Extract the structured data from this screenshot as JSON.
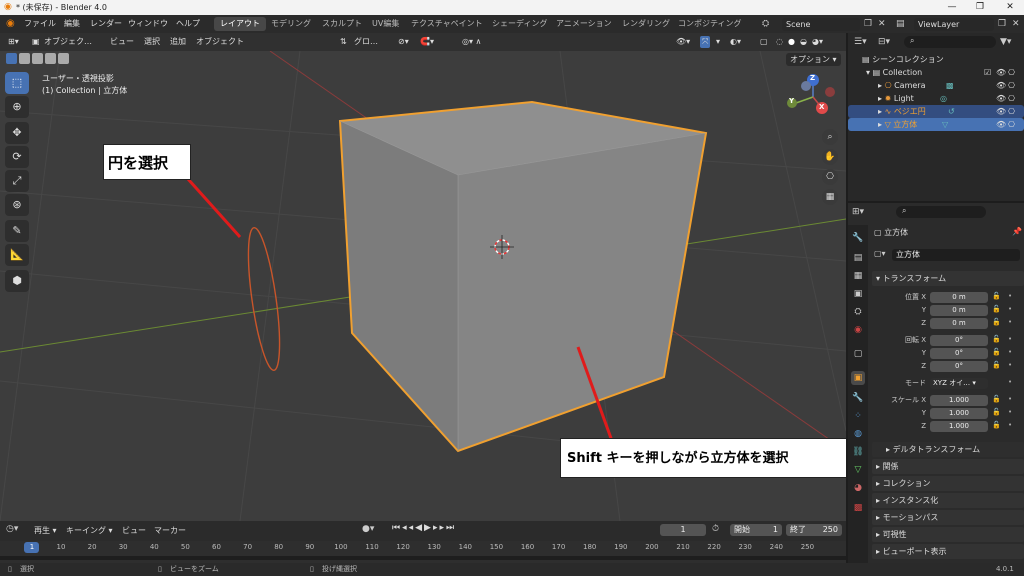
{
  "title_bar": {
    "text": "* (未保存) - Blender 4.0",
    "min": "—",
    "max": "❐",
    "close": "✕"
  },
  "menu": {
    "items": [
      "ファイル",
      "編集",
      "レンダー",
      "ウィンドウ",
      "ヘルプ"
    ],
    "workspaces": [
      "レイアウト",
      "モデリング",
      "スカルプト",
      "UV編集",
      "テクスチャペイント",
      "シェーディング",
      "アニメーション",
      "レンダリング",
      "コンポジティング"
    ],
    "scene": "Scene",
    "view_layer": "ViewLayer"
  },
  "viewport_header": {
    "mode": "オブジェク…",
    "menus": [
      "ビュー",
      "選択",
      "追加",
      "オブジェクト"
    ],
    "transform_orientation": "グロ…",
    "options": "オプション"
  },
  "viewport": {
    "view_name": "ユーザー・透視投影",
    "context": "(1) Collection | 立方体",
    "gizmo": {
      "z": "Z",
      "y": "Y",
      "x": "X"
    }
  },
  "annotations": {
    "circle_select": "円を選択",
    "shift_select": "Shift キーを押しながら立方体を選択"
  },
  "timeline": {
    "menus": [
      "再生",
      "キーイング",
      "ビュー",
      "マーカー"
    ],
    "current_frame": "1",
    "start_label": "開始",
    "start": "1",
    "end_label": "終了",
    "end": "250",
    "ticks": [
      "1",
      "10",
      "20",
      "30",
      "40",
      "50",
      "60",
      "70",
      "80",
      "90",
      "100",
      "110",
      "120",
      "130",
      "140",
      "150",
      "160",
      "170",
      "180",
      "190",
      "200",
      "210",
      "220",
      "230",
      "240",
      "250"
    ]
  },
  "outliner": {
    "root": "シーンコレクション",
    "collection": "Collection",
    "items": [
      "Camera",
      "Light",
      "ベジエ円",
      "立方体"
    ]
  },
  "properties": {
    "object_name": "立方体",
    "object_field": "立方体",
    "transform_header": "トランスフォーム",
    "location_label": "位置 X",
    "y_label": "Y",
    "z_label": "Z",
    "x_label": "X",
    "location": [
      "0 m",
      "0 m",
      "0 m"
    ],
    "rotation_label": "回転 X",
    "rotation": [
      "0°",
      "0°",
      "0°"
    ],
    "mode_label": "モード",
    "mode_value": "XYZ オイ…",
    "scale_label": "スケール X",
    "scale": [
      "1.000",
      "1.000",
      "1.000"
    ],
    "panels": [
      "デルタトランスフォーム",
      "関係",
      "コレクション",
      "インスタンス化",
      "モーションパス",
      "可視性",
      "ビューポート表示"
    ]
  },
  "status_bar": {
    "select": "選択",
    "zoom": "ビューをズーム",
    "lasso": "投げ縄選択",
    "version": "4.0.1"
  },
  "colors": {
    "accent": "#4772b3",
    "selection_outline": "#f0a030",
    "annotation_arrow": "#e01b1b"
  }
}
